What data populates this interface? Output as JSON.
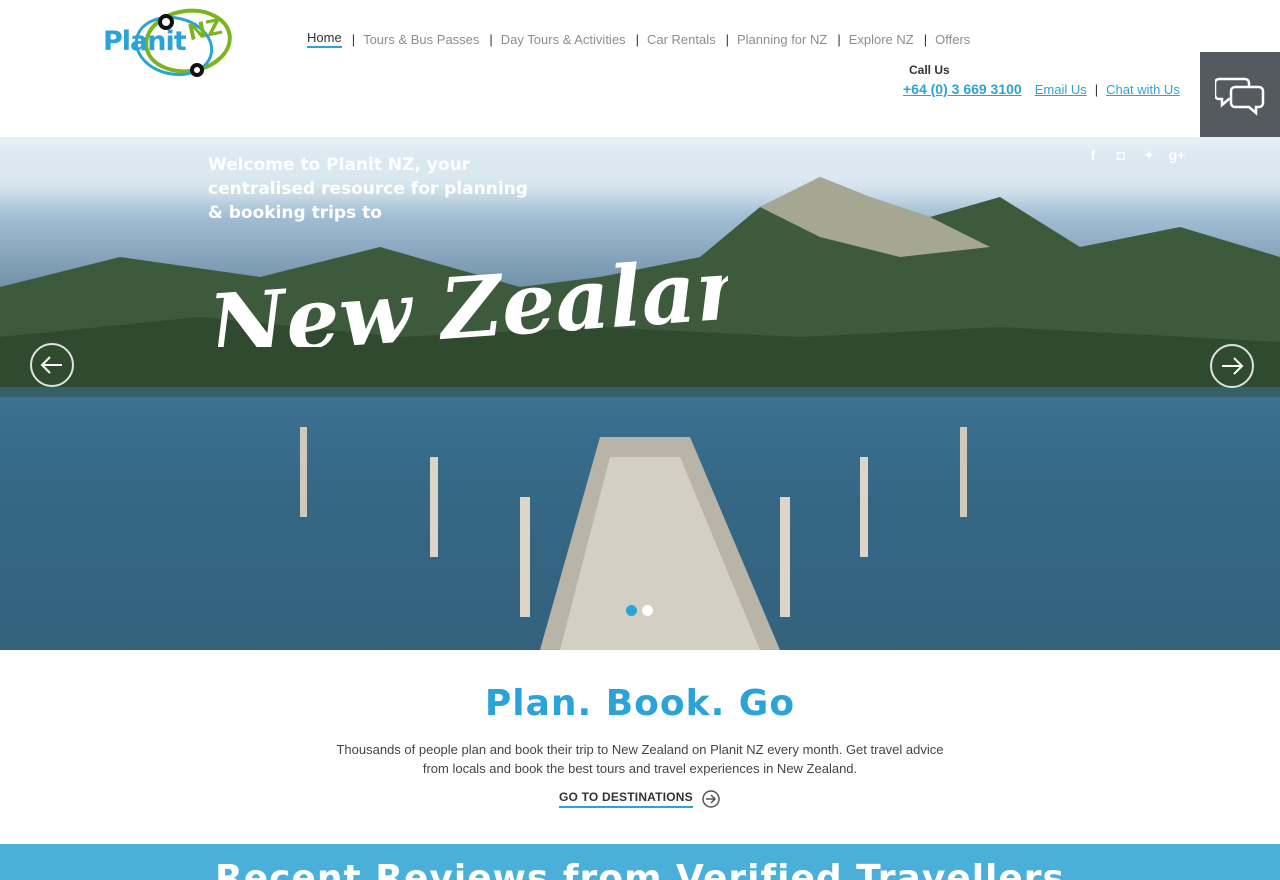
{
  "brand": {
    "logo_word": "Planit",
    "logo_nz": "NZ"
  },
  "nav": {
    "items": [
      {
        "label": "Home",
        "active": true
      },
      {
        "label": "Tours & Bus Passes"
      },
      {
        "label": "Day Tours & Activities"
      },
      {
        "label": "Car Rentals"
      },
      {
        "label": "Planning for NZ"
      },
      {
        "label": "Explore NZ"
      },
      {
        "label": "Offers"
      }
    ],
    "separator": "|"
  },
  "contact": {
    "heading": "Call Us",
    "phone": "+64 (0) 3 669 3100",
    "email_label": "Email Us",
    "chat_label": "Chat with Us",
    "separator": "|"
  },
  "chat_widget": {
    "icon": "speech-bubbles-icon"
  },
  "hero": {
    "intro": "Welcome to Planit NZ, your centralised resource for planning & booking trips to",
    "script_title": "New Zealand",
    "social_icons": [
      "facebook-icon",
      "instagram-icon",
      "twitter-icon",
      "google-plus-icon"
    ],
    "slides_total": 2,
    "active_slide": 1
  },
  "plan": {
    "title": "Plan. Book. Go",
    "body": "Thousands of people plan and book their trip to New Zealand on Planit NZ every month. Get travel advice from locals and book the best tours and travel experiences in New Zealand.",
    "cta": "GO TO DESTINATIONS"
  },
  "reviews": {
    "title": "Recent Reviews from Verified Travellers"
  },
  "colors": {
    "accent": "#2aa3d8",
    "green": "#7ab51d",
    "band": "#4ab0da",
    "chat_bg": "#555a60"
  }
}
